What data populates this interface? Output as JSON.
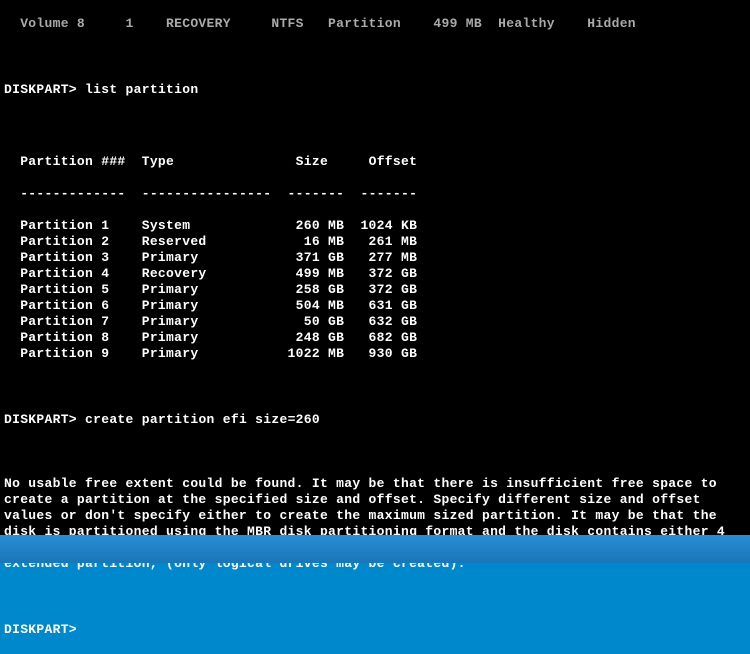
{
  "top_line": "  Volume 8     1    RECOVERY     NTFS   Partition    499 MB  Healthy    Hidden",
  "prompt": "DISKPART>",
  "command1": "list partition",
  "command2": "create partition efi size=260",
  "header": {
    "col1": "  Partition ###",
    "col2": "  Type",
    "col3": "    Size",
    "col4": "    Offset",
    "sep1": "  -------------",
    "sep2": "  ----------------",
    "sep3": "  -------",
    "sep4": "  -------"
  },
  "partitions": [
    {
      "num": "Partition 1",
      "type": "System",
      "size": "260 MB",
      "offset": "1024 KB"
    },
    {
      "num": "Partition 2",
      "type": "Reserved",
      "size": "16 MB",
      "offset": "261 MB"
    },
    {
      "num": "Partition 3",
      "type": "Primary",
      "size": "371 GB",
      "offset": "277 MB"
    },
    {
      "num": "Partition 4",
      "type": "Recovery",
      "size": "499 MB",
      "offset": "372 GB"
    },
    {
      "num": "Partition 5",
      "type": "Primary",
      "size": "258 GB",
      "offset": "372 GB"
    },
    {
      "num": "Partition 6",
      "type": "Primary",
      "size": "504 MB",
      "offset": "631 GB"
    },
    {
      "num": "Partition 7",
      "type": "Primary",
      "size": "50 GB",
      "offset": "632 GB"
    },
    {
      "num": "Partition 8",
      "type": "Primary",
      "size": "248 GB",
      "offset": "682 GB"
    },
    {
      "num": "Partition 9",
      "type": "Primary",
      "size": "1022 MB",
      "offset": "930 GB"
    }
  ],
  "error_message": "No usable free extent could be found. It may be that there is insufficient free space to create a partition at the specified size and offset. Specify different size and offset values or don't specify either to create the maximum sized partition. It may be that the disk is partitioned using the MBR disk partitioning format and the disk contains either 4 primary partitions, (no more partitions may be created), or 3 primary partitions and one extended partition, (only logical drives may be created)."
}
